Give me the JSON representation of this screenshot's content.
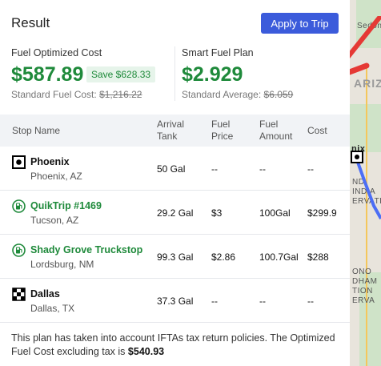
{
  "map": {
    "labels": [
      "Sedon",
      "ARIZ",
      "nix",
      "ND",
      "INDIA",
      "ERVATI",
      "ONO",
      "DHAM",
      "TION",
      "ERVA"
    ]
  },
  "panel": {
    "title": "Result",
    "apply_button": "Apply to Trip"
  },
  "summary": {
    "optimized": {
      "label": "Fuel Optimized Cost",
      "value": "$587.89",
      "save_badge": "Save $628.33",
      "sub_label": "Standard Fuel Cost:",
      "sub_value": "$1,216.22"
    },
    "smart": {
      "label": "Smart Fuel Plan",
      "value": "$2.929",
      "sub_label": "Standard Average:",
      "sub_value": "$6.059"
    }
  },
  "table": {
    "headers": {
      "stop_name": "Stop Name",
      "arrival_tank_1": "Arrival",
      "arrival_tank_2": "Tank",
      "fuel_price_1": "Fuel",
      "fuel_price_2": "Price",
      "fuel_amount_1": "Fuel",
      "fuel_amount_2": "Amount",
      "cost": "Cost"
    },
    "rows": [
      {
        "name": "Phoenix",
        "location": "Phoenix, AZ",
        "arrival_tank": "50 Gal",
        "fuel_price": "--",
        "fuel_amount": "--",
        "cost": "--"
      },
      {
        "name": "QuikTrip #1469",
        "location": "Tucson, AZ",
        "arrival_tank": "29.2 Gal",
        "fuel_price": "$3",
        "fuel_amount": "100Gal",
        "cost": "$299.9"
      },
      {
        "name": "Shady Grove Truckstop",
        "location": "Lordsburg, NM",
        "arrival_tank": "99.3 Gal",
        "fuel_price": "$2.86",
        "fuel_amount": "100.7Gal",
        "cost": "$288"
      },
      {
        "name": "Dallas",
        "location": "Dallas, TX",
        "arrival_tank": "37.3 Gal",
        "fuel_price": "--",
        "fuel_amount": "--",
        "cost": "--"
      }
    ]
  },
  "footnote": {
    "text": "This plan has taken into account IFTAs tax return policies. The Optimized Fuel Cost excluding tax is",
    "value": "$540.93"
  },
  "colors": {
    "accent": "#3b5bdb",
    "green": "#1f8a3b",
    "arrow": "#e53935"
  }
}
